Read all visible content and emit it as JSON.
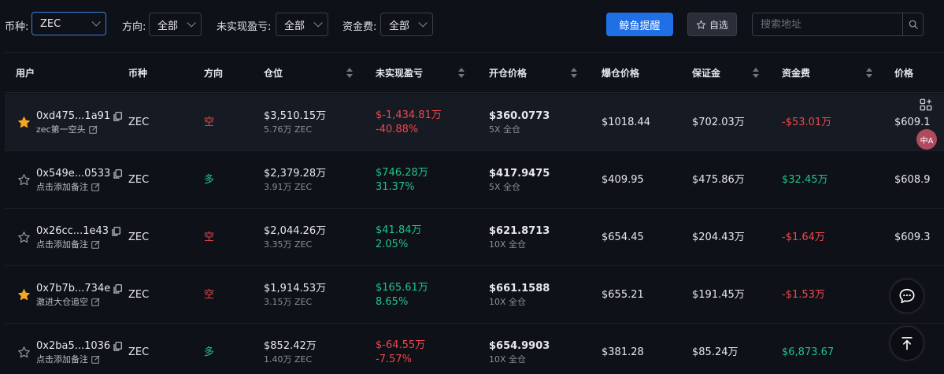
{
  "filters": {
    "coin_label": "币种:",
    "coin_value": "ZEC",
    "direction_label": "方向:",
    "direction_value": "全部",
    "pnl_label": "未实现盈亏:",
    "pnl_value": "全部",
    "funding_label": "资金费:",
    "funding_value": "全部"
  },
  "toolbar": {
    "whale_alert_label": "鲸鱼提醒",
    "watchlist_label": "自选",
    "search_placeholder": "搜索地址"
  },
  "table": {
    "headers": [
      "用户",
      "币种",
      "方向",
      "仓位",
      "未实现盈亏",
      "开仓价格",
      "爆仓价格",
      "保证金",
      "资金费",
      "价格"
    ],
    "rows": [
      {
        "starred": true,
        "address": "0xd475...1a91",
        "note": "zec第一空头",
        "coin": "ZEC",
        "direction": "空",
        "direction_type": "short",
        "position_value": "$3,510.15万",
        "position_size": "5.76万 ZEC",
        "pnl_value": "$-1,434.81万",
        "pnl_pct": "-40.88%",
        "pnl_type": "loss",
        "entry_price": "$360.0773",
        "leverage": "5X 全仓",
        "liq_price": "$1018.44",
        "margin": "$702.03万",
        "funding": "-$53.01万",
        "funding_type": "neg",
        "price": "$609.1"
      },
      {
        "starred": false,
        "address": "0x549e...0533",
        "note": "点击添加备注",
        "coin": "ZEC",
        "direction": "多",
        "direction_type": "long",
        "position_value": "$2,379.28万",
        "position_size": "3.91万 ZEC",
        "pnl_value": "$746.28万",
        "pnl_pct": "31.37%",
        "pnl_type": "profit",
        "entry_price": "$417.9475",
        "leverage": "5X 全仓",
        "liq_price": "$409.95",
        "margin": "$475.86万",
        "funding": "$32.45万",
        "funding_type": "pos",
        "price": "$608.9"
      },
      {
        "starred": false,
        "address": "0x26cc...1e43",
        "note": "点击添加备注",
        "coin": "ZEC",
        "direction": "空",
        "direction_type": "short",
        "position_value": "$2,044.26万",
        "position_size": "3.35万 ZEC",
        "pnl_value": "$41.84万",
        "pnl_pct": "2.05%",
        "pnl_type": "profit",
        "entry_price": "$621.8713",
        "leverage": "10X 全仓",
        "liq_price": "$654.45",
        "margin": "$204.43万",
        "funding": "-$1.64万",
        "funding_type": "neg",
        "price": "$609.3"
      },
      {
        "starred": true,
        "address": "0x7b7b...734e",
        "note": "激进大仓追空",
        "coin": "ZEC",
        "direction": "空",
        "direction_type": "short",
        "position_value": "$1,914.53万",
        "position_size": "3.15万 ZEC",
        "pnl_value": "$165.61万",
        "pnl_pct": "8.65%",
        "pnl_type": "profit",
        "entry_price": "$661.1588",
        "leverage": "10X 全仓",
        "liq_price": "$655.21",
        "margin": "$191.45万",
        "funding": "-$1.53万",
        "funding_type": "neg",
        "price": ""
      },
      {
        "starred": false,
        "address": "0x2ba5...1036",
        "note": "点击添加备注",
        "coin": "ZEC",
        "direction": "多",
        "direction_type": "long",
        "position_value": "$852.42万",
        "position_size": "1.40万 ZEC",
        "pnl_value": "$-64.55万",
        "pnl_pct": "-7.57%",
        "pnl_type": "loss",
        "entry_price": "$654.9903",
        "leverage": "10X 全仓",
        "liq_price": "$381.28",
        "margin": "$85.24万",
        "funding": "$6,873.67",
        "funding_type": "pos",
        "price": ""
      }
    ]
  },
  "floating": {
    "translate_badge": "中A"
  },
  "colors": {
    "loss": "#f0484e",
    "profit": "#1fc48a",
    "primary": "#1f6fe5",
    "star": "#f5a623"
  }
}
